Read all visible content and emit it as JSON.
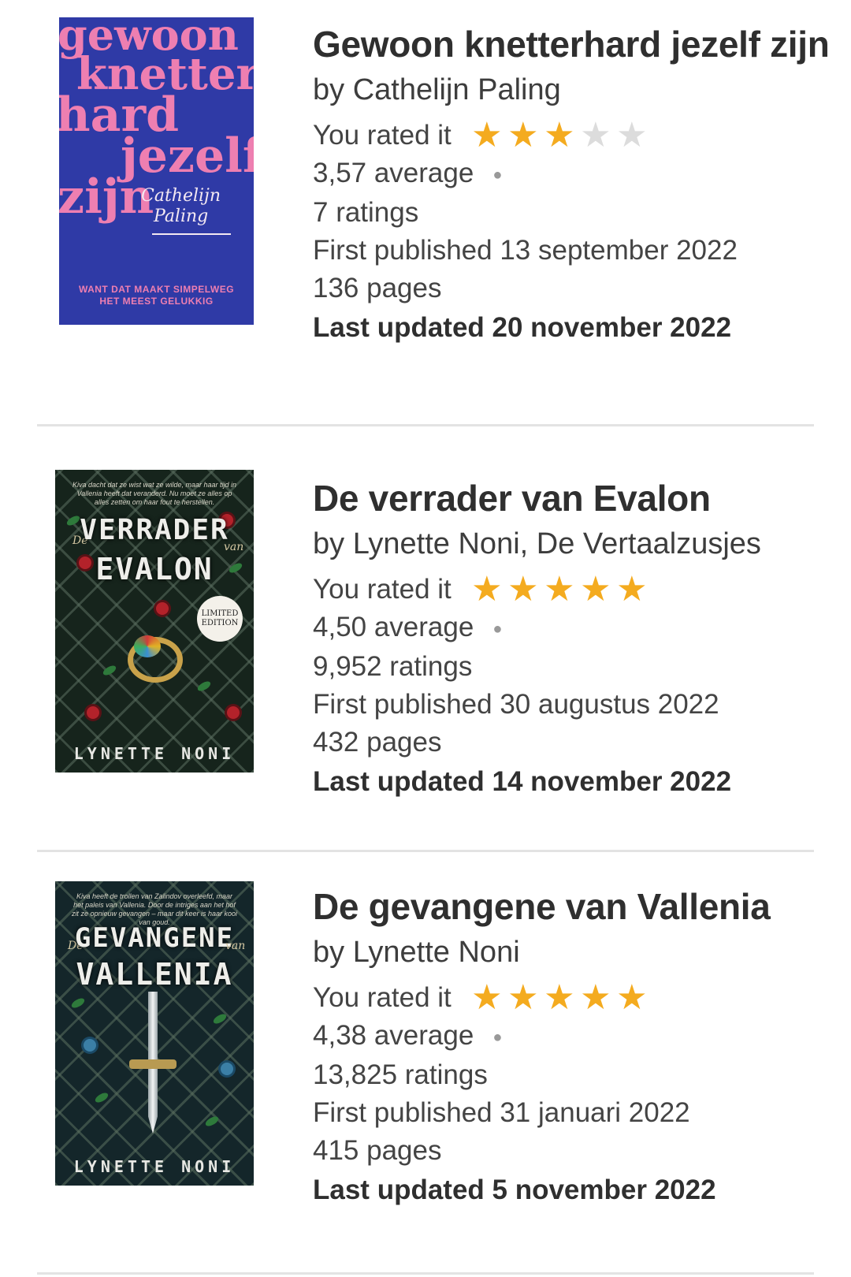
{
  "books": [
    {
      "title": "Gewoon knetterhard jezelf zijn",
      "author": "by Cathelijn Paling",
      "rated_label": "You rated it",
      "rating": 3,
      "max_rating": 5,
      "average": "3,57 average",
      "ratings": "7 ratings",
      "published": "First published 13 september 2022",
      "pages": "136 pages",
      "updated": "Last updated 20 november 2022",
      "cover": {
        "lines": [
          "gewoon",
          "knetter",
          "hard",
          "jezelf",
          "zijn"
        ],
        "signature": [
          "Cathelijn",
          "Paling"
        ],
        "tagline": [
          "WANT DAT MAAKT SIMPELWEG",
          "HET MEEST GELUKKIG"
        ]
      }
    },
    {
      "title": "De verrader van Evalon",
      "author": "by Lynette Noni, De Vertaalzusjes",
      "rated_label": "You rated it",
      "rating": 5,
      "max_rating": 5,
      "average": "4,50 average",
      "ratings": "9,952 ratings",
      "published": "First published 30 augustus 2022",
      "pages": "432 pages",
      "updated": "Last updated 14 november 2022",
      "cover": {
        "blurb": "Kiva dacht dat ze wist wat ze wilde, maar haar tijd in Vallenia heeft dat veranderd. Nu moet ze alles op alles zetten om haar fout te herstellen.",
        "de": "De",
        "title1": "VERRADER",
        "van": "van",
        "title2": "EVALON",
        "badge": [
          "LIMITED",
          "EDITION"
        ],
        "author": "LYNETTE NONI"
      }
    },
    {
      "title": "De gevangene van Vallenia",
      "author": "by Lynette Noni",
      "rated_label": "You rated it",
      "rating": 5,
      "max_rating": 5,
      "average": "4,38 average",
      "ratings": "13,825 ratings",
      "published": "First published 31 januari 2022",
      "pages": "415 pages",
      "updated": "Last updated 5 november 2022",
      "cover": {
        "blurb": "Kiva heeft de trollen van Zalindov overleefd, maar het paleis van Vallenia. Door de intriges aan het hof zit ze opnieuw gevangen – maar dit keer is haar kooi van goud.",
        "de": "De",
        "title1": "GEVANGENE",
        "van": "van",
        "title2": "VALLENIA",
        "author": "LYNETTE NONI"
      }
    }
  ],
  "colors": {
    "star_on": "#f4ab1f",
    "star_off": "#dcdcdc",
    "divider": "#e3e3e3",
    "cover1_bg": "#2f3aa6",
    "cover1_text": "#ee7fb1"
  },
  "icons": {
    "star": "star-icon",
    "separator": "dot-separator"
  }
}
